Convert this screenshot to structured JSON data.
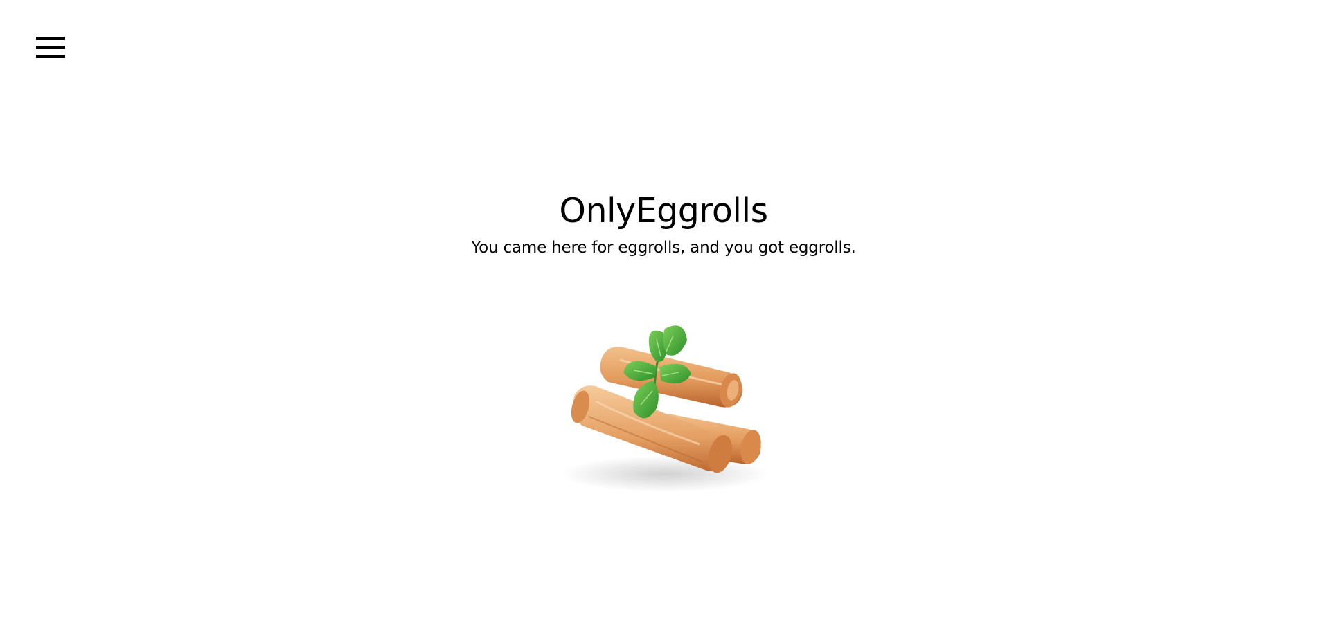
{
  "header": {
    "menu_icon": "hamburger-menu-icon"
  },
  "hero": {
    "title": "OnlyEggrolls",
    "subtitle": "You came here for eggrolls, and you got eggrolls."
  },
  "image": {
    "subject": "eggrolls-with-mint-image"
  },
  "colors": {
    "background": "#ffffff",
    "text": "#000000",
    "eggroll_light": "#e9a86a",
    "eggroll_dark": "#c4733a",
    "mint": "#4caf3c"
  }
}
